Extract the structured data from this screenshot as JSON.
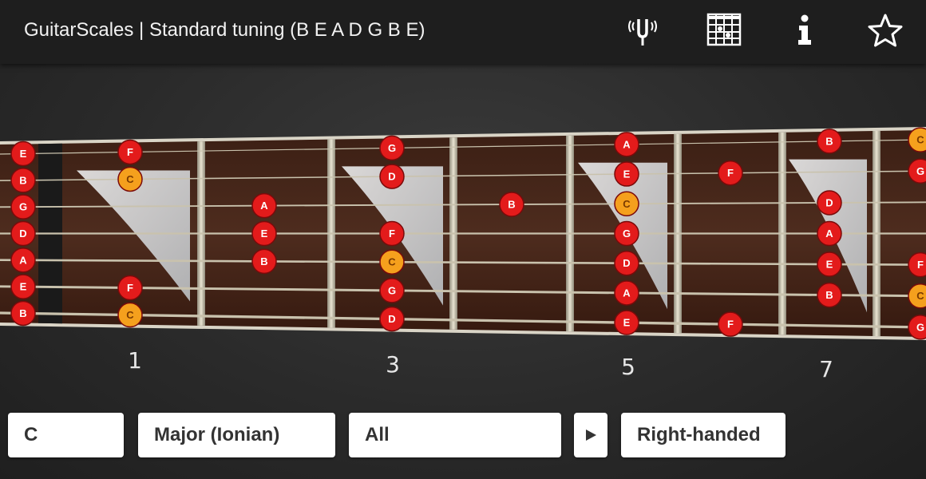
{
  "app": {
    "title": "GuitarScales | Standard tuning (B E A D G B E)",
    "actions": [
      {
        "name": "tuning-fork-icon",
        "label": "Tuner"
      },
      {
        "name": "chord-chart-icon",
        "label": "Chord chart"
      },
      {
        "name": "info-icon",
        "label": "Info"
      },
      {
        "name": "star-icon",
        "label": "Favorite"
      }
    ]
  },
  "colors": {
    "note": "#e31b1b",
    "root": "#f5a01d",
    "fretboard": "#4a2a1c",
    "appbar": "#1e1e1e"
  },
  "fretboard": {
    "open_strings": [
      "E",
      "B",
      "G",
      "D",
      "A",
      "E",
      "B"
    ],
    "fret_numbers": [
      "1",
      "3",
      "5",
      "7"
    ],
    "notes": [
      {
        "string": 1,
        "fret": 1,
        "label": "F"
      },
      {
        "string": 1,
        "fret": 3,
        "label": "G"
      },
      {
        "string": 1,
        "fret": 5,
        "label": "A"
      },
      {
        "string": 1,
        "fret": 7,
        "label": "B"
      },
      {
        "string": 1,
        "fret": 8,
        "label": "C",
        "root": true
      },
      {
        "string": 2,
        "fret": 1,
        "label": "C",
        "root": true
      },
      {
        "string": 2,
        "fret": 3,
        "label": "D"
      },
      {
        "string": 2,
        "fret": 5,
        "label": "E"
      },
      {
        "string": 2,
        "fret": 6,
        "label": "F"
      },
      {
        "string": 2,
        "fret": 8,
        "label": "G"
      },
      {
        "string": 3,
        "fret": 2,
        "label": "A"
      },
      {
        "string": 3,
        "fret": 4,
        "label": "B"
      },
      {
        "string": 3,
        "fret": 5,
        "label": "C",
        "root": true
      },
      {
        "string": 3,
        "fret": 7,
        "label": "D"
      },
      {
        "string": 4,
        "fret": 2,
        "label": "E"
      },
      {
        "string": 4,
        "fret": 3,
        "label": "F"
      },
      {
        "string": 4,
        "fret": 5,
        "label": "G"
      },
      {
        "string": 4,
        "fret": 7,
        "label": "A"
      },
      {
        "string": 5,
        "fret": 2,
        "label": "B"
      },
      {
        "string": 5,
        "fret": 3,
        "label": "C",
        "root": true
      },
      {
        "string": 5,
        "fret": 5,
        "label": "D"
      },
      {
        "string": 5,
        "fret": 7,
        "label": "E"
      },
      {
        "string": 5,
        "fret": 8,
        "label": "F"
      },
      {
        "string": 6,
        "fret": 1,
        "label": "F"
      },
      {
        "string": 6,
        "fret": 3,
        "label": "G"
      },
      {
        "string": 6,
        "fret": 5,
        "label": "A"
      },
      {
        "string": 6,
        "fret": 7,
        "label": "B"
      },
      {
        "string": 6,
        "fret": 8,
        "label": "C",
        "root": true
      },
      {
        "string": 7,
        "fret": 1,
        "label": "C",
        "root": true
      },
      {
        "string": 7,
        "fret": 3,
        "label": "D"
      },
      {
        "string": 7,
        "fret": 5,
        "label": "E"
      },
      {
        "string": 7,
        "fret": 6,
        "label": "F"
      },
      {
        "string": 7,
        "fret": 8,
        "label": "G"
      }
    ]
  },
  "controls": {
    "key": "C",
    "scale": "Major (Ionian)",
    "positions": "All",
    "play_icon": "play-icon",
    "handedness": "Right-handed"
  }
}
